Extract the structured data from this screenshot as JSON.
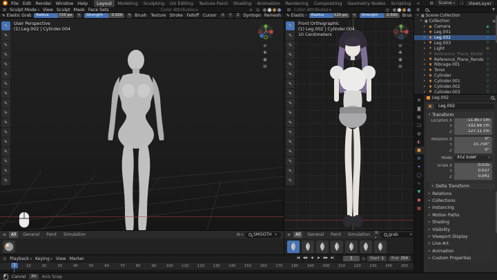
{
  "colors": {
    "accent": "#4772b3",
    "object_orange": "#e8933a",
    "mesh_green": "#3dbd8c",
    "axis_red": "#aa3e3e",
    "selection_blue": "#33517e"
  },
  "topbar": {
    "menus": [
      "File",
      "Edit",
      "Render",
      "Window",
      "Help"
    ],
    "workspaces": [
      {
        "label": "Layout",
        "active": true
      },
      {
        "label": "Modeling"
      },
      {
        "label": "Sculpting"
      },
      {
        "label": "UV Editing"
      },
      {
        "label": "Texture Paint"
      },
      {
        "label": "Shading"
      },
      {
        "label": "Animation"
      },
      {
        "label": "Rendering"
      },
      {
        "label": "Compositing"
      },
      {
        "label": "Geometry Nodes"
      },
      {
        "label": "Scripting"
      },
      {
        "label": "+"
      }
    ],
    "scene": "Scene",
    "viewlayer": "ViewLayer"
  },
  "header_left": {
    "mode": "Sculpt Mode",
    "menus": [
      "View",
      "Sculpt",
      "Mask",
      "Face Sets"
    ],
    "color_attributes": "Color Attributes"
  },
  "tool_left": {
    "tool": "Elastic Grab",
    "radius_label": "Radius",
    "radius_value": "725 px",
    "strength_label": "Strength",
    "strength_value": "0.500",
    "menus": [
      "Brush",
      "Texture",
      "Stroke",
      "Falloff",
      "Cursor"
    ],
    "symmetry": [
      "X",
      "Y",
      "Z"
    ],
    "extras": [
      "Dyntopo",
      "Remesh"
    ]
  },
  "header_right": {
    "color_attributes": "Color Attributes"
  },
  "tool_right": {
    "tool": "Elastic Grab",
    "radius_label": "Radius",
    "radius_value": "515 px",
    "strength_label": "Strength",
    "strength_value": "0.500",
    "menus": [
      "Brush"
    ]
  },
  "viewport_left": {
    "view": "User Perspective",
    "selection": "(1) Leg.002 | Cylinder.004"
  },
  "viewport_right": {
    "view": "Front Orthographic",
    "selection": "(1) Leg.002 | Cylinder.004",
    "scale": "10 Centimeters"
  },
  "vp_tools": [
    {
      "active": true
    },
    {},
    {},
    {},
    {},
    {},
    {},
    {},
    {},
    {},
    {},
    {},
    {},
    {},
    {},
    {},
    {}
  ],
  "shelf_left": {
    "tabs": [
      {
        "label": "All",
        "active": true
      },
      {
        "label": "General"
      },
      {
        "label": "Paint"
      },
      {
        "label": "Simulation"
      }
    ],
    "search": "SMOOTH",
    "brushes": [
      {}
    ]
  },
  "shelf_right": {
    "tabs": [
      {
        "label": "All",
        "active": true
      },
      {
        "label": "General"
      },
      {
        "label": "Paint"
      },
      {
        "label": "Simulation"
      }
    ],
    "search": "grab",
    "brushes": [
      {
        "selected": true
      },
      {},
      {},
      {},
      {},
      {},
      {}
    ]
  },
  "outliner": {
    "root": "Scene Collection",
    "collection": "Collection",
    "items": [
      {
        "name": "Camera",
        "type": "camera"
      },
      {
        "name": "Leg.001",
        "type": "mesh"
      },
      {
        "name": "Leg.002",
        "type": "mesh",
        "selected": true
      },
      {
        "name": "Leg.003",
        "type": "mesh"
      },
      {
        "name": "Light",
        "type": "light"
      },
      {
        "name": "Reference_Plane_Model",
        "type": "mesh",
        "muted": true
      },
      {
        "name": "Reference_Plane_Render",
        "type": "mesh"
      },
      {
        "name": "Ribcage.001",
        "type": "mesh"
      },
      {
        "name": "Torso",
        "type": "mesh"
      },
      {
        "name": "Cylinder",
        "type": "mesh"
      },
      {
        "name": "Cylinder.001",
        "type": "mesh"
      },
      {
        "name": "Cylinder.002",
        "type": "mesh"
      },
      {
        "name": "Cylinder.003",
        "type": "mesh"
      }
    ]
  },
  "properties": {
    "breadcrumb": "Leg.002",
    "object_name": "Leg.002",
    "transform_title": "Transform",
    "transform_rows": [
      {
        "label": "Location X",
        "value": "-11.857 cm"
      },
      {
        "label": "Y",
        "value": "-102.66 cm"
      },
      {
        "label": "Z",
        "value": "127.11 cm"
      },
      {
        "label": "Rotation X",
        "value": "0°",
        "gap": true
      },
      {
        "label": "Y",
        "value": "15.754°"
      },
      {
        "label": "Z",
        "value": "0°"
      },
      {
        "label": "Mode",
        "value": "XYZ Euler",
        "menu": true,
        "gap": true
      },
      {
        "label": "Scale X",
        "value": "0.035",
        "gap": true
      },
      {
        "label": "Y",
        "value": "0.037"
      },
      {
        "label": "Z",
        "value": "0.041"
      }
    ],
    "sections": [
      {
        "label": "Delta Transform",
        "sub": true
      },
      {
        "label": "Relations"
      },
      {
        "label": "Collections"
      },
      {
        "label": "Instancing"
      },
      {
        "label": "Motion Paths"
      },
      {
        "label": "Shading"
      },
      {
        "label": "Visibility"
      },
      {
        "label": "Viewport Display"
      },
      {
        "label": "Line Art"
      },
      {
        "label": "Animation"
      },
      {
        "label": "Custom Properties"
      }
    ],
    "tabs": [
      {
        "glyph": "⚒",
        "color": "#9a9a9a",
        "name": "tool"
      },
      {
        "glyph": "◙",
        "color": "#9a9a9a",
        "name": "render"
      },
      {
        "glyph": "▤",
        "color": "#9a9a9a",
        "name": "output"
      },
      {
        "glyph": "❏",
        "color": "#9a9a9a",
        "name": "view-layer"
      },
      {
        "glyph": "◍",
        "color": "#9a9a9a",
        "name": "scene"
      },
      {
        "glyph": "◐",
        "color": "#b86a6a",
        "name": "world"
      },
      {
        "glyph": "■",
        "color": "#e8933a",
        "active": true,
        "name": "object"
      },
      {
        "glyph": "⚙",
        "color": "#6f94cf",
        "name": "modifiers"
      },
      {
        "glyph": "✦",
        "color": "#6f94cf",
        "name": "particles"
      },
      {
        "glyph": "◯",
        "color": "#6f94cf",
        "name": "physics"
      },
      {
        "glyph": "∿",
        "color": "#9a9a9a",
        "name": "constraints"
      },
      {
        "glyph": "▼",
        "color": "#44c28d",
        "name": "object-data"
      },
      {
        "glyph": "●",
        "color": "#c45959",
        "name": "material"
      },
      {
        "glyph": "▦",
        "color": "#c45959",
        "name": "texture"
      }
    ]
  },
  "timeline": {
    "menus": [
      "Playback",
      "Keying",
      "View",
      "Marker"
    ],
    "buttons": [
      "|◀",
      "◀◀",
      "◀",
      "▶",
      "▶▶",
      "▶|"
    ],
    "ticks": [
      "10",
      "20",
      "30",
      "40",
      "50",
      "60",
      "70",
      "80",
      "90",
      "100",
      "110",
      "120",
      "130",
      "140",
      "150",
      "160",
      "170",
      "180",
      "190",
      "200",
      "210",
      "220",
      "230",
      "240",
      "250"
    ],
    "current": "1",
    "start_label": "Start",
    "start_value": "1",
    "end_label": "End",
    "end_value": "250"
  },
  "statusbar": {
    "action": "Cancel",
    "key": "Alt",
    "hint": "Axis Snap"
  }
}
